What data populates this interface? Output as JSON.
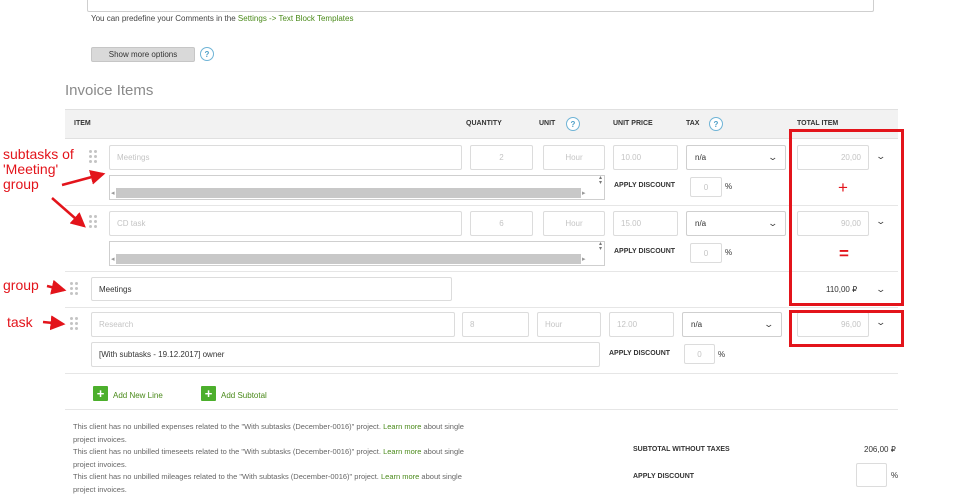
{
  "hint": {
    "prefix": "You can predefine your Comments in the ",
    "link": "Settings -> Text Block Templates"
  },
  "show_more_options": "Show more options",
  "section_title": "Invoice Items",
  "headers": {
    "item": "ITEM",
    "quantity": "QUANTITY",
    "unit": "UNIT",
    "unit_price": "UNIT PRICE",
    "tax": "TAX",
    "total_item": "TOTAL ITEM"
  },
  "rows": [
    {
      "name_placeholder": "Meetings",
      "qty": "2",
      "unit": "Hour",
      "price": "10.00",
      "tax": "n/a",
      "total": "20,00",
      "discount_label": "APPLY DISCOUNT",
      "discount_value": "0",
      "discount_unit": "%"
    },
    {
      "name_placeholder": "CD task",
      "qty": "6",
      "unit": "Hour",
      "price": "15.00",
      "tax": "n/a",
      "total": "90,00",
      "discount_label": "APPLY DISCOUNT",
      "discount_value": "0",
      "discount_unit": "%"
    }
  ],
  "group_row": {
    "name": "Meetings",
    "total": "110,00 ₽"
  },
  "task_row": {
    "name_placeholder": "Research",
    "qty": "8",
    "unit": "Hour",
    "price": "12.00",
    "tax": "n/a",
    "total": "96,00",
    "description": "[With subtasks - 19.12.2017]  owner",
    "discount_label": "APPLY DISCOUNT",
    "discount_value": "0",
    "discount_unit": "%"
  },
  "actions": {
    "add_new_line": "Add New Line",
    "add_subtotal": "Add Subtotal"
  },
  "notes": [
    {
      "a": "This client has no unbilled expenses related to the \"With subtasks (December-0016)\" project. ",
      "link": "Learn more",
      "b": " about single",
      "c": "project invoices."
    },
    {
      "a": "This client has no unbilled timeseets related to the \"With subtasks (December-0016)\" project. ",
      "link": "Learn more",
      "b": " about single",
      "c": "project invoices."
    },
    {
      "a": "This client has no unbilled mileages related to the \"With subtasks (December-0016)\" project. ",
      "link": "Learn more",
      "b": " about single",
      "c": "project invoices."
    }
  ],
  "summary": {
    "subtotal_label": "SUBTOTAL WITHOUT TAXES",
    "subtotal_value": "206,00 ₽",
    "discount_label": "APPLY DISCOUNT",
    "discount_unit": "%"
  },
  "annotations": {
    "subtasks": [
      "subtasks of",
      "'Meeting'",
      "group"
    ],
    "group": "group",
    "task": "task",
    "plus": "+",
    "equals": "="
  },
  "colors": {
    "annotation_red": "#e3141b",
    "link_green": "#4a8a1a",
    "button_green": "#4caf2c",
    "help_blue": "#4fa0c8"
  },
  "icons": [
    "question-circle-icon",
    "drag-handle-icon",
    "chevron-down-icon",
    "plus-icon",
    "red-arrow-icon"
  ]
}
